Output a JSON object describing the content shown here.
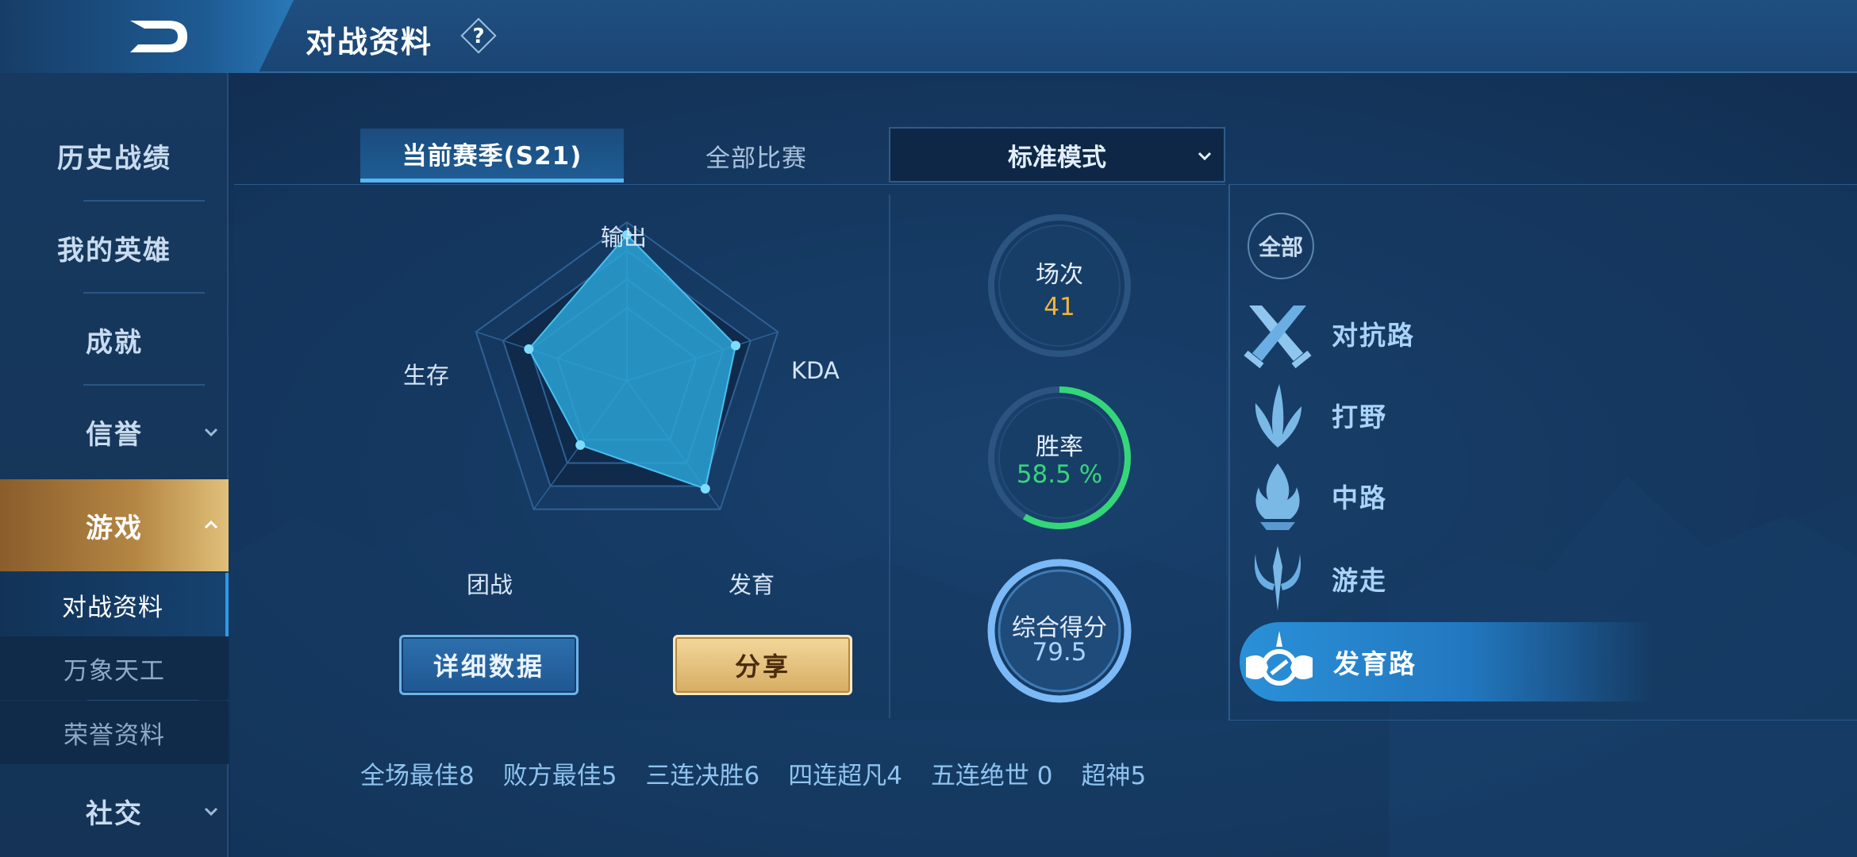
{
  "header": {
    "title": "对战资料",
    "help_symbol": "?"
  },
  "sidebar": {
    "items": [
      {
        "label": "历史战绩"
      },
      {
        "label": "我的英雄"
      },
      {
        "label": "成就"
      },
      {
        "label": "信誉"
      },
      {
        "label": "游戏"
      },
      {
        "label": "社交"
      }
    ],
    "sub_items": [
      {
        "label": "对战资料"
      },
      {
        "label": "万象天工"
      },
      {
        "label": "荣誉资料"
      }
    ]
  },
  "tabs": [
    {
      "label": "当前赛季(S21)"
    },
    {
      "label": "全部比赛"
    }
  ],
  "mode_select": {
    "selected": "标准模式"
  },
  "radar": {
    "labels": {
      "output": "输出",
      "kda": "KDA",
      "growth": "发育",
      "teamfight": "团战",
      "survival": "生存"
    },
    "values": {
      "output": 0.92,
      "kda": 0.72,
      "growth": 0.84,
      "teamfight": 0.5,
      "survival": 0.65
    }
  },
  "buttons": {
    "detail": "详细数据",
    "share": "分享"
  },
  "stats": {
    "matches": {
      "label": "场次",
      "value": "41"
    },
    "win_rate": {
      "label": "胜率",
      "value": "58.5 %",
      "fraction": 0.585
    },
    "score": {
      "label": "综合得分",
      "value": "79.5"
    }
  },
  "roles": {
    "all": "全部",
    "items": [
      {
        "label": "对抗路"
      },
      {
        "label": "打野"
      },
      {
        "label": "中路"
      },
      {
        "label": "游走"
      },
      {
        "label": "发育路"
      }
    ]
  },
  "bottom_stats": [
    "全场最佳8",
    "败方最佳5",
    "三连决胜6",
    "四连超凡4",
    "五连绝世 0",
    "超神5"
  ],
  "colors": {
    "accent_blue": "#55b8f5",
    "win_green": "#35d67a",
    "matches_gold": "#f2b43a",
    "radar_fill": "#2aa3d6"
  }
}
